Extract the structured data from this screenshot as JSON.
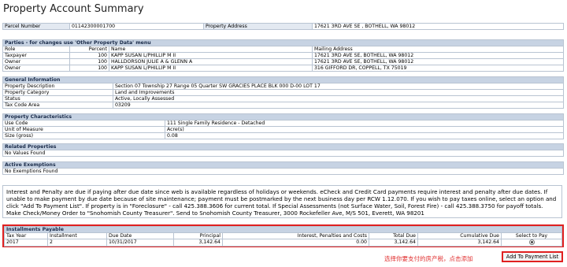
{
  "title": "Property Account Summary",
  "parcel": {
    "label": "Parcel Number",
    "value": "01142300001700",
    "addr_label": "Property Address",
    "addr_value": "17621 3RD AVE SE , BOTHELL, WA 98012"
  },
  "parties": {
    "header": "Parties - for changes use 'Other Property Data' menu",
    "cols": [
      "Role",
      "Percent",
      "Name",
      "Mailing Address"
    ],
    "rows": [
      [
        "Taxpayer",
        "100",
        "KAPP SUSAN L/PHILLIP M II",
        "17621 3RD AVE SE, BOTHELL, WA 98012"
      ],
      [
        "Owner",
        "100",
        "HALLDORSON JULIE A & GLENN A",
        "17621 3RD AVE SE, BOTHELL, WA 98012"
      ],
      [
        "Owner",
        "100",
        "KAPP SUSAN L/PHILLIP M II",
        "316 GIFFORD DR, COPPELL, TX 75019"
      ]
    ]
  },
  "general": {
    "header": "General Information",
    "rows": [
      [
        "Property Description",
        "Section 07 Township 27 Range 05 Quarter SW GRACIES PLACE BLK 000 D-00 LOT 17"
      ],
      [
        "Property Category",
        "Land and Improvements"
      ],
      [
        "Status",
        "Active, Locally Assessed"
      ],
      [
        "Tax Code Area",
        "03209"
      ]
    ]
  },
  "characteristics": {
    "header": "Property Characteristics",
    "rows": [
      [
        "Use Code",
        "111 Single Family Residence - Detached"
      ],
      [
        "Unit of Measure",
        "Acre(s)"
      ],
      [
        "Size (gross)",
        "0.08"
      ]
    ]
  },
  "related": {
    "header": "Related Properties",
    "value": "No Values Found"
  },
  "exemptions": {
    "header": "Active Exemptions",
    "value": "No Exemptions Found"
  },
  "notice": "Interest and Penalty are due if paying after due date since web is available regardless of holidays or weekends. eCheck and Credit Card payments require interest and penalty after due dates. If unable to make payment by due date because of site maintenance; payment must be postmarked by the next business day per RCW 1.12.070. If you wish to pay taxes online, select an option and click \"Add To Payment List\". If property is in \"Foreclosure\" - call 425.388.3606 for current total. If Special Assessments (not Surface Water, Soil, Forest Fire) - call 425.388.3750 for payoff totals. Make Check/Money Order to \"Snohomish County Treasurer\". Send to Snohomish County Treasurer, 3000 Rockefeller Ave, M/S 501, Everett, WA 98201",
  "installments": {
    "header": "Installments Payable",
    "cols": [
      "Tax Year",
      "Installment",
      "Due Date",
      "Principal",
      "Interest, Penalties and Costs",
      "Total Due",
      "Cumulative Due",
      "Select to Pay"
    ],
    "row": [
      "2017",
      "2",
      "10/31/2017",
      "3,142.64",
      "0.00",
      "3,142.64",
      "3,142.64"
    ]
  },
  "annotation": "选择你要支付的房产税，点击添加",
  "add_button": "Add To Payment List"
}
